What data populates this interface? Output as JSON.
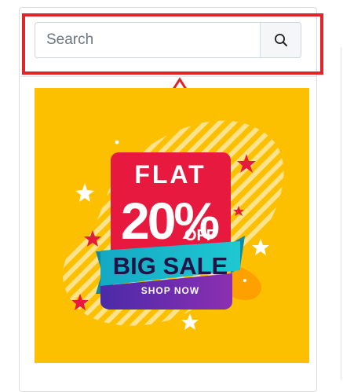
{
  "search": {
    "placeholder": "Search",
    "value": ""
  },
  "banner": {
    "line1": "FLAT",
    "percent": "20%",
    "off": "OFF",
    "sale": "BIG SALE",
    "cta": "SHOP NOW"
  },
  "colors": {
    "highlight": "#e02428",
    "banner_bg": "#fdc000",
    "tag_red": "#e8193e",
    "ribbon_teal": "#19b7c8",
    "ribbon_purple": "#6a2fb0"
  },
  "icons": {
    "search_button": "search-icon",
    "callout": "arrow-up-icon"
  }
}
